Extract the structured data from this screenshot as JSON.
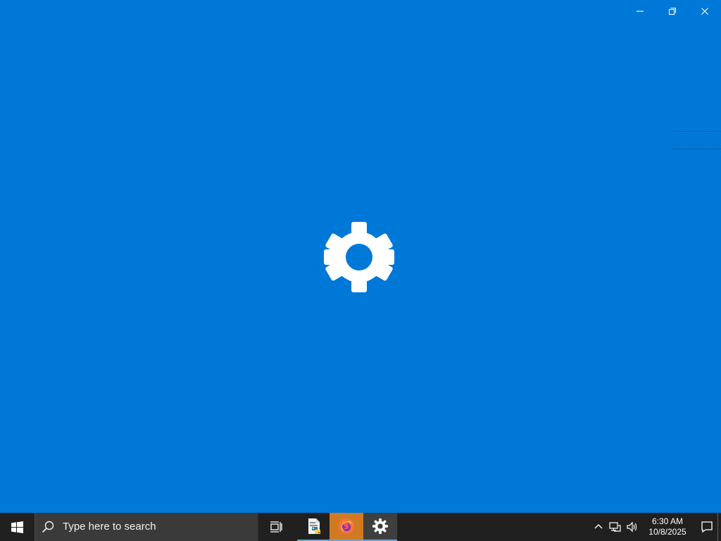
{
  "window": {
    "controls": [
      {
        "name": "minimize",
        "icon": "minimize-icon"
      },
      {
        "name": "restore",
        "icon": "restore-icon"
      },
      {
        "name": "close",
        "icon": "close-icon"
      }
    ]
  },
  "splash": {
    "app_icon": "settings-gear-icon",
    "background": "#0078d7",
    "foreground": "#ffffff"
  },
  "taskbar": {
    "background": "#202020",
    "start_icon": "windows-logo-icon",
    "search": {
      "placeholder": "Type here to search",
      "icon": "search-icon"
    },
    "apps": [
      {
        "icon": "task-view-icon",
        "active": false
      },
      {
        "icon": "python-file-icon",
        "active": false,
        "running": true
      },
      {
        "icon": "firefox-icon",
        "active": false,
        "running": true,
        "highlight": "#d07a24"
      },
      {
        "icon": "settings-gear-icon",
        "active": true,
        "running": true
      }
    ],
    "tray": {
      "icons": [
        "chevron-up-icon",
        "network-icon",
        "volume-icon",
        "notification-icon"
      ],
      "time": "6:30 AM",
      "date": "10/8/2025"
    },
    "accent": "#6ca6db"
  }
}
